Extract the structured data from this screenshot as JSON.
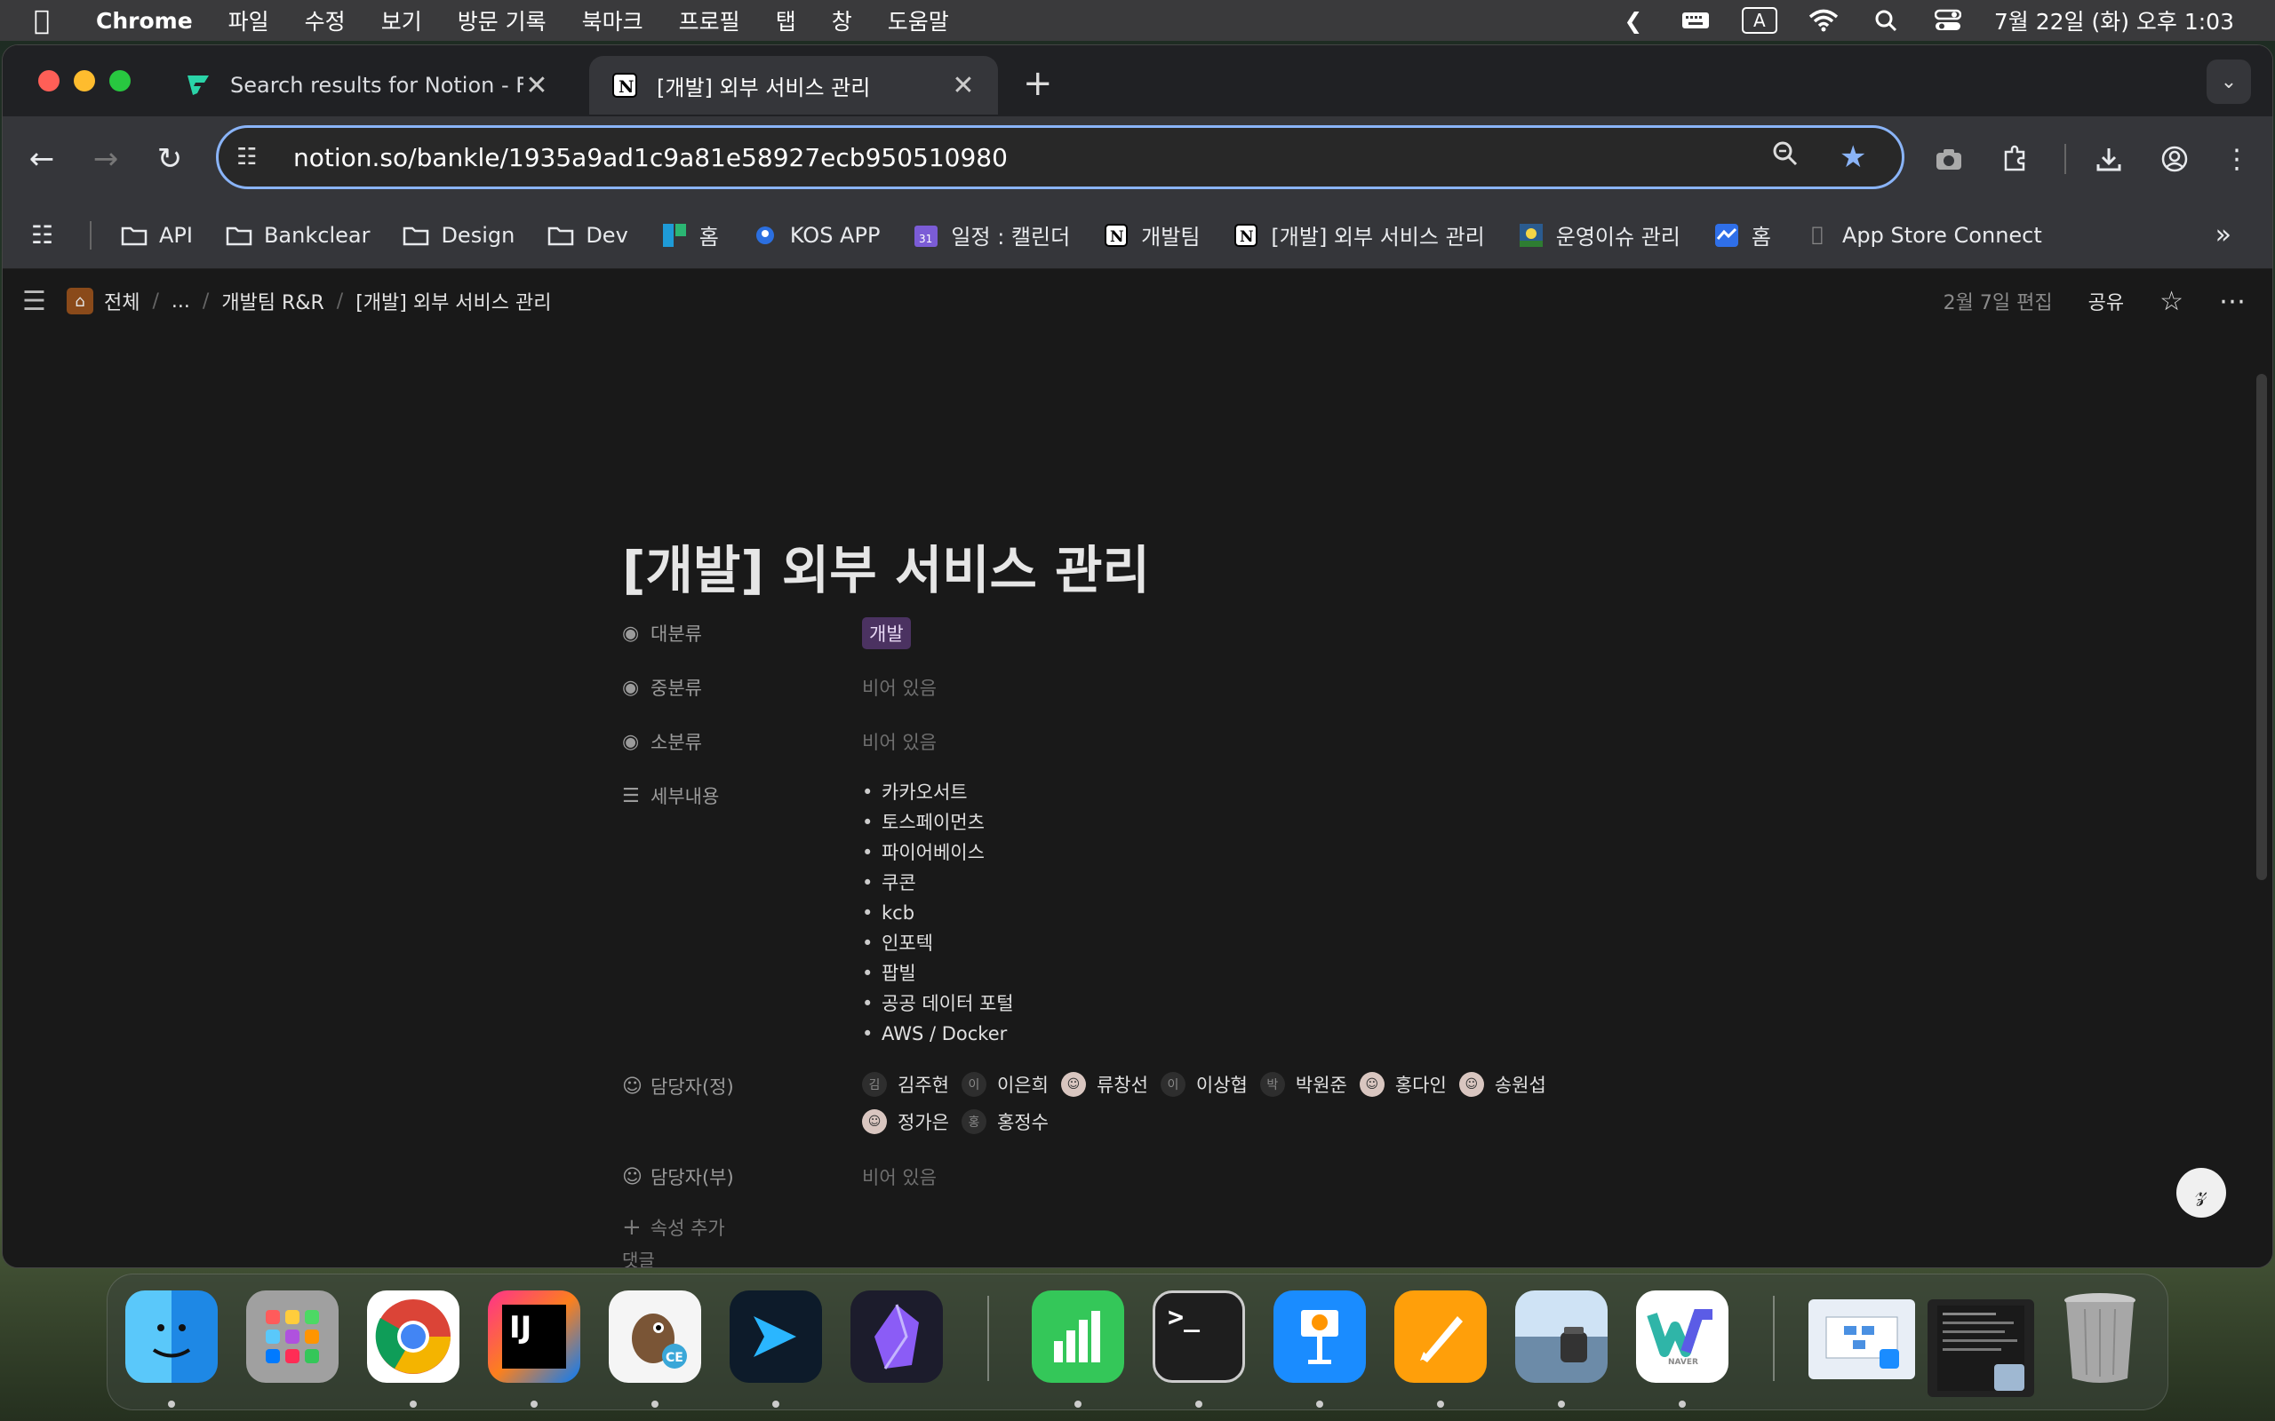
{
  "menubar": {
    "app_name": "Chrome",
    "menus": [
      "파일",
      "수정",
      "보기",
      "방문 기록",
      "북마크",
      "프로필",
      "탭",
      "창",
      "도움말"
    ],
    "input_indicator": "A",
    "datetime": "7월 22일 (화) 오후 1:03"
  },
  "tabs": [
    {
      "title": "Search results for Notion - Fla",
      "icon": "flaticon-icon"
    },
    {
      "title": "[개발] 외부 서비스 관리",
      "icon": "notion-icon"
    }
  ],
  "omnibox": {
    "url": "notion.so/bankle/1935a9ad1c9a81e58927ecb950510980"
  },
  "bookmarks": [
    {
      "label": "API",
      "icon": "folder-icon"
    },
    {
      "label": "Bankclear",
      "icon": "folder-icon"
    },
    {
      "label": "Design",
      "icon": "folder-icon"
    },
    {
      "label": "Dev",
      "icon": "folder-icon"
    },
    {
      "label": "홈",
      "icon": "board-icon"
    },
    {
      "label": "KOS APP",
      "icon": "kos-icon"
    },
    {
      "label": "일정 : 캘린더",
      "icon": "calendar-icon"
    },
    {
      "label": "개발팀",
      "icon": "notion-icon"
    },
    {
      "label": "[개발] 외부 서비스 관리",
      "icon": "notion-icon"
    },
    {
      "label": "운영이슈 관리",
      "icon": "image-icon"
    },
    {
      "label": "홈",
      "icon": "chart-icon"
    },
    {
      "label": "App Store Connect",
      "icon": "apple-icon"
    }
  ],
  "notion": {
    "breadcrumb": [
      "전체",
      "...",
      "개발팀 R&R",
      "[개발] 외부 서비스 관리"
    ],
    "edited": "2월 7일 편집",
    "share": "공유",
    "title": "[개발] 외부 서비스 관리",
    "props": {
      "major": {
        "key": "대분류",
        "value": "개발"
      },
      "middle": {
        "key": "중분류",
        "value": "비어 있음"
      },
      "minor": {
        "key": "소분류",
        "value": "비어 있음"
      },
      "detail": {
        "key": "세부내용",
        "items": [
          "카카오서트",
          "토스페이먼츠",
          "파이어베이스",
          "쿠콘",
          "kcb",
          "인포텍",
          "팝빌",
          "공공 데이터 포털",
          "AWS / Docker"
        ]
      },
      "owner_main": {
        "key": "담당자(정)",
        "people": [
          {
            "initial": "김",
            "name": "김주현"
          },
          {
            "initial": "이",
            "name": "이은희"
          },
          {
            "initial": "",
            "name": "류창선"
          },
          {
            "initial": "이",
            "name": "이상협"
          },
          {
            "initial": "박",
            "name": "박원준"
          },
          {
            "initial": "",
            "name": "홍다인"
          },
          {
            "initial": "",
            "name": "송원섭"
          },
          {
            "initial": "",
            "name": "정가은"
          },
          {
            "initial": "홍",
            "name": "홍정수"
          }
        ]
      },
      "owner_sub": {
        "key": "담당자(부)",
        "value": "비어 있음"
      }
    },
    "add_property": "속성 추가",
    "comments": "댓글"
  },
  "dock": {
    "apps": [
      "Finder",
      "Launchpad",
      "Chrome",
      "IntelliJ IDEA CE",
      "DBeaver CE",
      "Xcode Cloud",
      "Obsidian",
      "Numbers",
      "Terminal",
      "Keynote",
      "Pages",
      "Preview",
      "Naver Whale",
      "Trash"
    ]
  },
  "colors": {
    "tag_bg": "#4b3261",
    "accent": "#8ab4f8"
  }
}
